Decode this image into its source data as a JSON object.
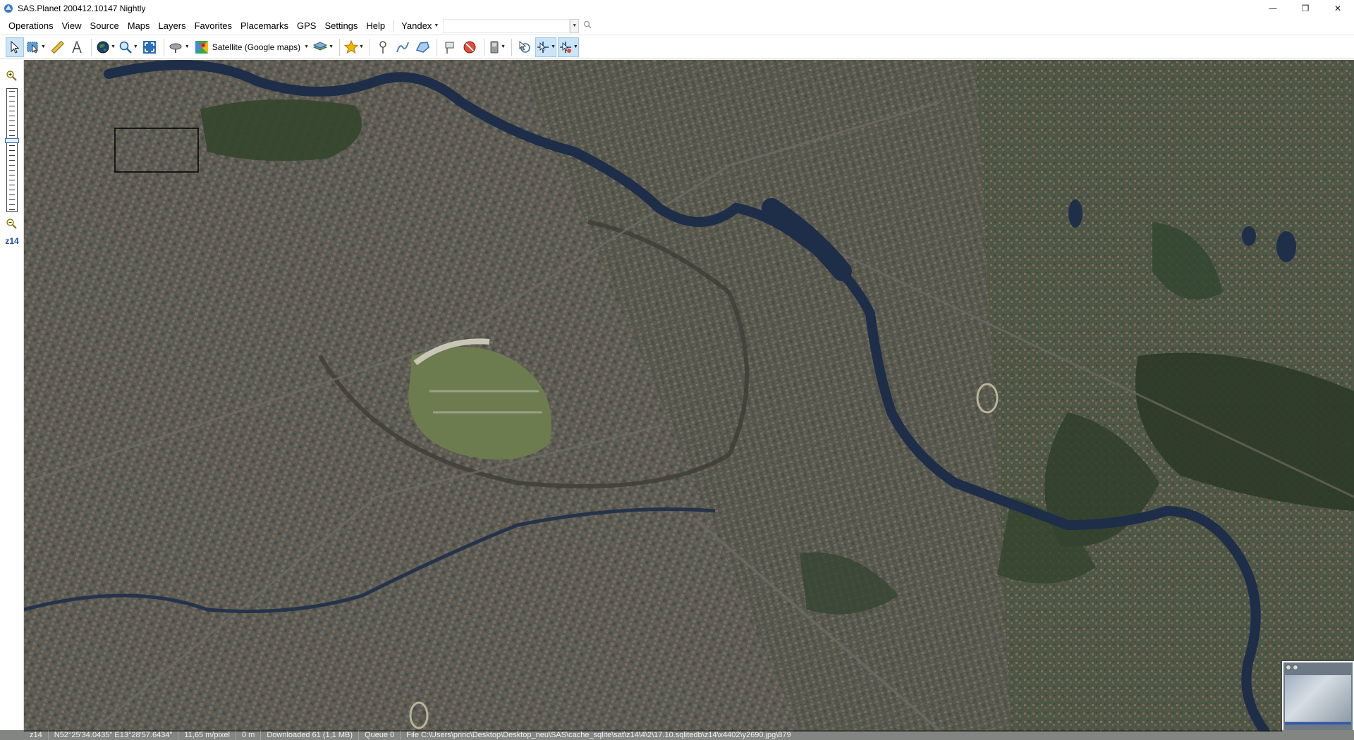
{
  "window": {
    "title": "SAS.Planet 200412.10147 Nightly",
    "controls": {
      "minimize": "—",
      "maximize": "❐",
      "close": "✕"
    }
  },
  "menu": {
    "items": [
      "Operations",
      "View",
      "Source",
      "Maps",
      "Layers",
      "Favorites",
      "Placemarks",
      "GPS",
      "Settings",
      "Help"
    ],
    "search_provider": "Yandex",
    "search_value": ""
  },
  "toolbar": {
    "map_source_label": "Satellite (Google maps)",
    "icons": [
      "pointer-icon",
      "selection-icon",
      "ruler-icon",
      "compass-icon",
      "globe-icon",
      "magnifier-icon",
      "fullscreen-icon",
      "satellite-dish-icon",
      "google-maps-icon",
      "layers-icon",
      "star-icon",
      "placemark-icon",
      "path-icon",
      "polygon-icon",
      "marks-icon",
      "delete-marks-icon",
      "gps-icon",
      "cursor-target-icon",
      "cursor-select-icon",
      "cursor-move-icon"
    ]
  },
  "zoom": {
    "label": "z14",
    "level": 14,
    "max_level": 24
  },
  "status": {
    "zoom": "z14",
    "coordinates": "N52°25'34.0435\" E13°28'57.6434\"",
    "scale": "11,65 m/pixel",
    "distance": "0 m",
    "downloaded": "Downloaded 61 (1,1 MB)",
    "queue": "Queue 0",
    "file": "File C:\\Users\\princ\\Desktop\\Desktop_neu\\SAS\\cache_sqlite\\sat\\z14\\4\\2\\17.10.sqlitedb\\z14\\x4402\\y2690.jpg\\879"
  },
  "colors": {
    "accent": "#1a4fa0",
    "pressed_button": "#cce4f7",
    "river": "#1e2d48",
    "forest": "#2e3b28"
  }
}
